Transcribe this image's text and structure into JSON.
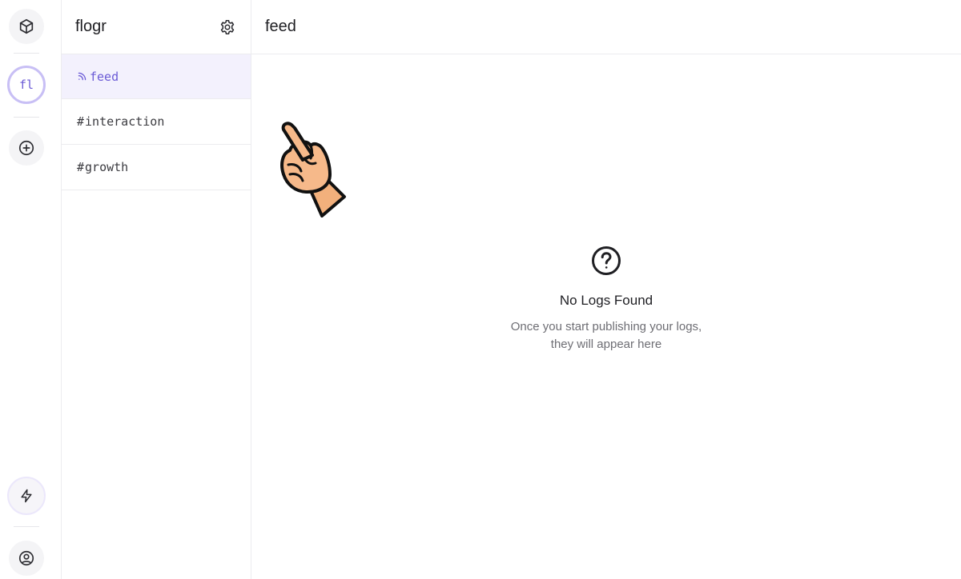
{
  "app": {
    "workspace_initials": "fl",
    "name": "flogr"
  },
  "sidebar": {
    "channels": [
      {
        "label": "feed",
        "icon": "rss-icon",
        "active": true
      },
      {
        "prefix": "#",
        "label": "interaction",
        "active": false
      },
      {
        "prefix": "#",
        "label": "growth",
        "active": false
      }
    ]
  },
  "main": {
    "title": "feed",
    "empty_state": {
      "icon": "question-circle-icon",
      "title": "No Logs Found",
      "line1": "Once you start publishing your logs,",
      "line2": "they will appear here"
    }
  },
  "colors": {
    "accent": "#6b5bd6",
    "accent_bg": "#f3f1fd",
    "border": "#ececef"
  }
}
